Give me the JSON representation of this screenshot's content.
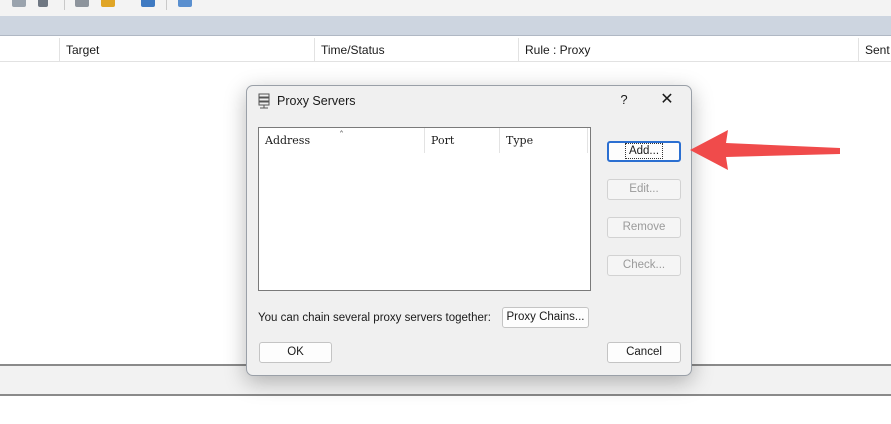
{
  "app": {
    "toolbar_icons": [
      "printer-icon",
      "magnifier-icon",
      "home-icon",
      "folder-icon",
      "chart-icon",
      "settings-icon"
    ],
    "columns": [
      "Target",
      "Time/Status",
      "Rule : Proxy",
      "Sent"
    ]
  },
  "dialog": {
    "title": "Proxy Servers",
    "help_label": "?",
    "close_label": "✕",
    "list_columns": [
      "Address",
      "Port",
      "Type"
    ],
    "sort_indicator": "ˆ",
    "buttons": {
      "add": "Add...",
      "edit": "Edit...",
      "remove": "Remove",
      "check": "Check..."
    },
    "chain_text": "You can chain several proxy servers together:",
    "chains_button": "Proxy Chains...",
    "ok_button": "OK",
    "cancel_button": "Cancel"
  },
  "colors": {
    "annotation_arrow": "#f04b4b",
    "default_button_border": "#2b6fd1",
    "header_band": "#cdd5e0"
  }
}
